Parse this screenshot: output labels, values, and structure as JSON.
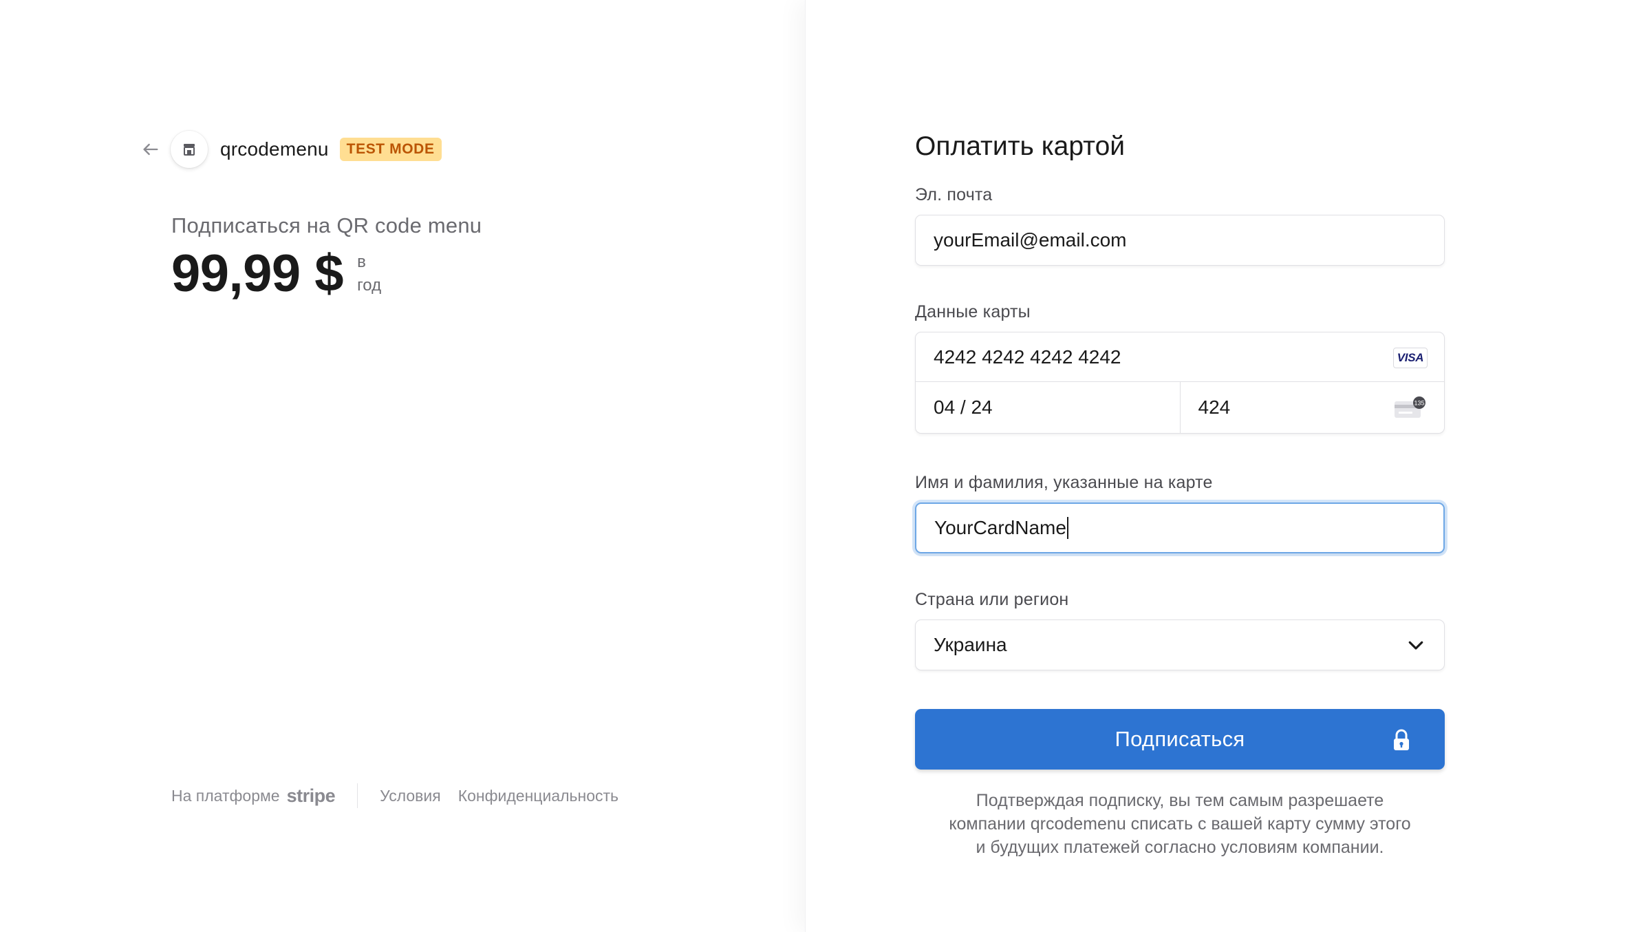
{
  "merchant": {
    "name": "qrcodemenu",
    "badge": "TEST MODE"
  },
  "product": {
    "name": "Подписаться на QR code menu",
    "price": "99,99 $",
    "period_line1": "в",
    "period_line2": "год"
  },
  "footer": {
    "powered_by": "На платформе",
    "brand": "stripe",
    "terms": "Условия",
    "privacy": "Конфиденциальность"
  },
  "form": {
    "title": "Оплатить картой",
    "email_label": "Эл. почта",
    "email_value": "yourEmail@email.com",
    "card_label": "Данные карты",
    "card_number": "4242 4242 4242 4242",
    "card_brand": "VISA",
    "card_expiry": "04 / 24",
    "card_cvc": "424",
    "cvc_hint": "135",
    "name_label": "Имя и фамилия, указанные на карте",
    "name_value": "YourCardName",
    "country_label": "Страна или регион",
    "country_value": "Украина",
    "submit_label": "Подписаться",
    "consent_line1": "Подтверждая подписку, вы тем самым разрешаете",
    "consent_line2": "компании qrcodemenu списать с вашей карту сумму этого",
    "consent_line3": "и будущих платежей согласно условиям компании."
  },
  "colors": {
    "accent": "#2d74d2",
    "badge_bg": "#ffde92",
    "badge_text": "#bb5504",
    "focus_ring": "#6da7e6"
  },
  "icons": {
    "back": "arrow-left-icon",
    "merchant": "store-icon",
    "card_brand": "visa-icon",
    "cvc": "card-cvc-icon",
    "select": "chevron-down-icon",
    "submit": "lock-icon"
  }
}
